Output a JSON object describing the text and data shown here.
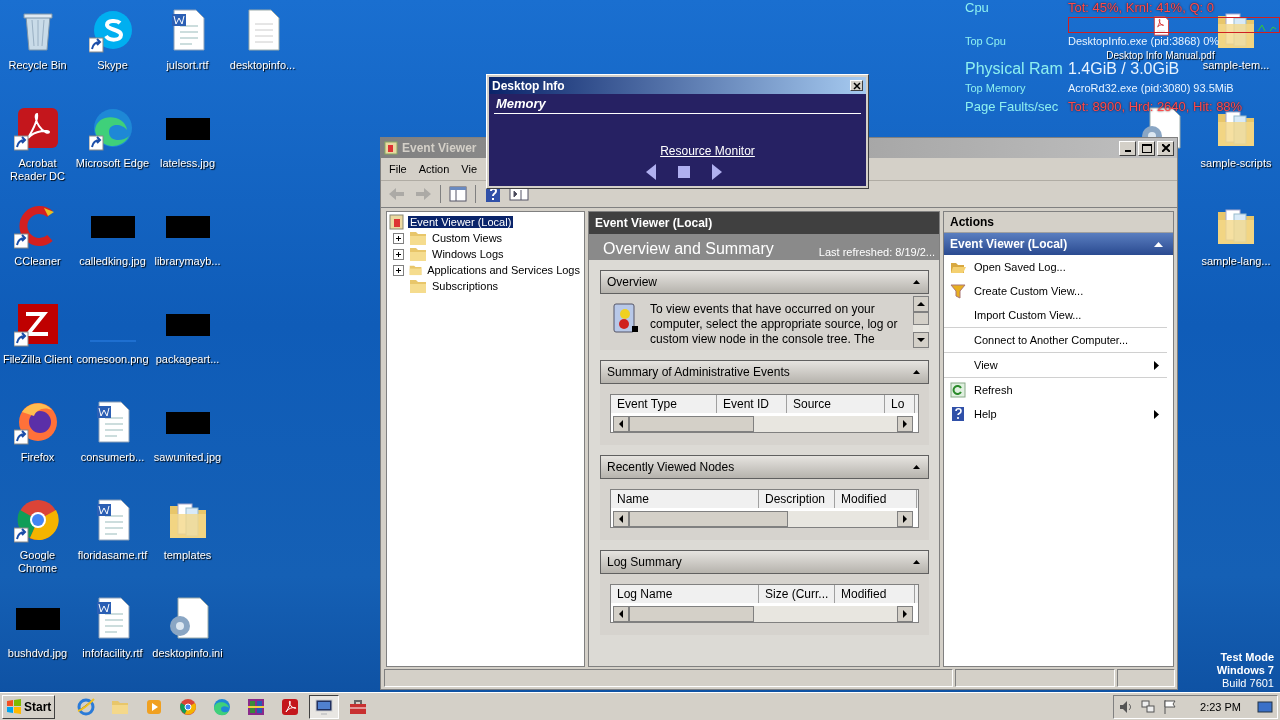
{
  "system_monitor": {
    "rows": [
      {
        "label": "Cpu",
        "value": "Tot: 45%, Krnl: 41%, Q: 0",
        "kind": "medium",
        "alert": true
      },
      {
        "label": "Top Cpu",
        "value": "DesktopInfo.exe (pid:3868) 0%",
        "kind": "small",
        "alert": false
      },
      {
        "label": "Physical Ram",
        "value": "1.4GiB / 3.0GiB",
        "kind": "large",
        "alert": false
      },
      {
        "label": "Top Memory",
        "value": "AcroRd32.exe (pid:3080) 93.5MiB",
        "kind": "small",
        "alert": false
      },
      {
        "label": "Page Faults/sec",
        "value": "Tot: 8900, Hrd: 2640, Hit: 88%",
        "kind": "medium",
        "alert": true
      }
    ]
  },
  "desktop_icons": [
    {
      "label": "Recycle Bin",
      "kind": "bin",
      "shortcut": false
    },
    {
      "label": "Acrobat Reader DC",
      "kind": "acrobat",
      "shortcut": true
    },
    {
      "label": "CCleaner",
      "kind": "ccleaner",
      "shortcut": true
    },
    {
      "label": "FileZilla Client",
      "kind": "filezilla",
      "shortcut": true
    },
    {
      "label": "Firefox",
      "kind": "firefox",
      "shortcut": true
    },
    {
      "label": "Google Chrome",
      "kind": "chrome",
      "shortcut": true
    },
    {
      "label": "bushdvd.jpg",
      "kind": "image",
      "shortcut": false
    },
    {
      "label": "Skype",
      "kind": "skype",
      "shortcut": true
    },
    {
      "label": "Microsoft Edge",
      "kind": "edge",
      "shortcut": true
    },
    {
      "label": "calledking.jpg",
      "kind": "image",
      "shortcut": false
    },
    {
      "label": "comesoon.png",
      "kind": "blank",
      "shortcut": false
    },
    {
      "label": "consumerb...",
      "kind": "doc",
      "shortcut": false
    },
    {
      "label": "floridasame.rtf",
      "kind": "doc",
      "shortcut": false
    },
    {
      "label": "infofacility.rtf",
      "kind": "doc",
      "shortcut": false
    },
    {
      "label": "julsort.rtf",
      "kind": "doc",
      "shortcut": false
    },
    {
      "label": "lateless.jpg",
      "kind": "image",
      "shortcut": false
    },
    {
      "label": "librarymayb...",
      "kind": "image",
      "shortcut": false
    },
    {
      "label": "packageart...",
      "kind": "image",
      "shortcut": false
    },
    {
      "label": "sawunited.jpg",
      "kind": "image",
      "shortcut": false
    },
    {
      "label": "templates",
      "kind": "folder",
      "shortcut": false
    },
    {
      "label": "desktopinfo.ini",
      "kind": "ini",
      "shortcut": false
    },
    {
      "label": "desktopinfo...",
      "kind": "file",
      "shortcut": false
    }
  ],
  "desktop_icons_right": [
    {
      "label": "Desktop Info Manual.pdf",
      "kind": "pdf",
      "shortcut": false
    },
    {
      "label": "sample-tem...",
      "kind": "folder",
      "shortcut": false
    },
    {
      "label": "sample-scripts",
      "kind": "folder",
      "shortcut": false
    },
    {
      "label": "sample-lang...",
      "kind": "folder",
      "shortcut": false
    }
  ],
  "event_viewer": {
    "title": "Event Viewer",
    "menu": [
      "File",
      "Action",
      "Vie"
    ],
    "toolbar": [
      {
        "kind": "back",
        "disabled": true
      },
      {
        "kind": "forward",
        "disabled": true
      },
      {
        "kind": "tree",
        "disabled": false
      },
      {
        "kind": "help",
        "disabled": false
      },
      {
        "kind": "panel",
        "disabled": false
      }
    ],
    "tree": [
      {
        "label": "Event Viewer (Local)",
        "kind": "root",
        "selected": true,
        "expander": false,
        "expanded": true,
        "children": [
          {
            "label": "Custom Views",
            "kind": "folder",
            "selected": false,
            "expander": true,
            "expanded": false
          },
          {
            "label": "Windows Logs",
            "kind": "folder",
            "selected": false,
            "expander": true,
            "expanded": false
          },
          {
            "label": "Applications and Services Logs",
            "kind": "folder",
            "selected": false,
            "expander": true,
            "expanded": false
          },
          {
            "label": "Subscriptions",
            "kind": "folder",
            "selected": false,
            "expander": false
          }
        ]
      }
    ],
    "center": {
      "header": "Event Viewer (Local)",
      "title": "Overview and Summary",
      "last_refreshed": "Last refreshed: 8/19/2...",
      "sections": [
        {
          "title": "Overview",
          "kind": "text",
          "expanded": true,
          "text": "To view events that have occurred on your computer, select the appropriate source, log or custom view node in the console tree. The"
        },
        {
          "title": "Summary of Administrative Events",
          "kind": "table",
          "expanded": true,
          "columns": [
            "Event Type",
            "Event ID",
            "Source",
            "Lo"
          ]
        },
        {
          "title": "Recently Viewed Nodes",
          "kind": "table",
          "expanded": true,
          "columns": [
            "Name",
            "Description",
            "Modified"
          ]
        },
        {
          "title": "Log Summary",
          "kind": "table",
          "expanded": true,
          "columns": [
            "Log Name",
            "Size (Curr...",
            "Modified"
          ]
        }
      ]
    },
    "actions": {
      "header": "Actions",
      "group": "Event Viewer (Local)",
      "expanded": true,
      "items": [
        {
          "label": "Open Saved Log...",
          "kind": "open",
          "submenu": false,
          "divider_after": false
        },
        {
          "label": "Create Custom View...",
          "kind": "filter",
          "submenu": false,
          "divider_after": false
        },
        {
          "label": "Import Custom View...",
          "kind": "none",
          "submenu": false,
          "divider_after": true
        },
        {
          "label": "Connect to Another Computer...",
          "kind": "none",
          "submenu": false,
          "divider_after": true
        },
        {
          "label": "View",
          "kind": "none",
          "submenu": true,
          "divider_after": true
        },
        {
          "label": "Refresh",
          "kind": "refresh",
          "submenu": false,
          "divider_after": false
        },
        {
          "label": "Help",
          "kind": "help",
          "submenu": true,
          "divider_after": false
        }
      ]
    }
  },
  "desktop_info_popup": {
    "title": "Desktop Info",
    "heading": "Memory",
    "link": "Resource Monitor"
  },
  "system_info": [
    "Test Mode",
    "Windows 7",
    "Build 7601"
  ],
  "taskbar": {
    "start": "Start",
    "items": [
      {
        "kind": "ie",
        "selected": false
      },
      {
        "kind": "explorer",
        "selected": false
      },
      {
        "kind": "media",
        "selected": false
      },
      {
        "kind": "chrome",
        "selected": false
      },
      {
        "kind": "edge",
        "selected": false
      },
      {
        "kind": "winrar",
        "selected": false
      },
      {
        "kind": "acrobat",
        "selected": false
      },
      {
        "kind": "monitor",
        "selected": true
      },
      {
        "kind": "toolbox",
        "selected": false
      }
    ],
    "tray": [
      {
        "kind": "speaker"
      },
      {
        "kind": "network"
      },
      {
        "kind": "flag"
      }
    ],
    "clock": "2:23 PM"
  }
}
